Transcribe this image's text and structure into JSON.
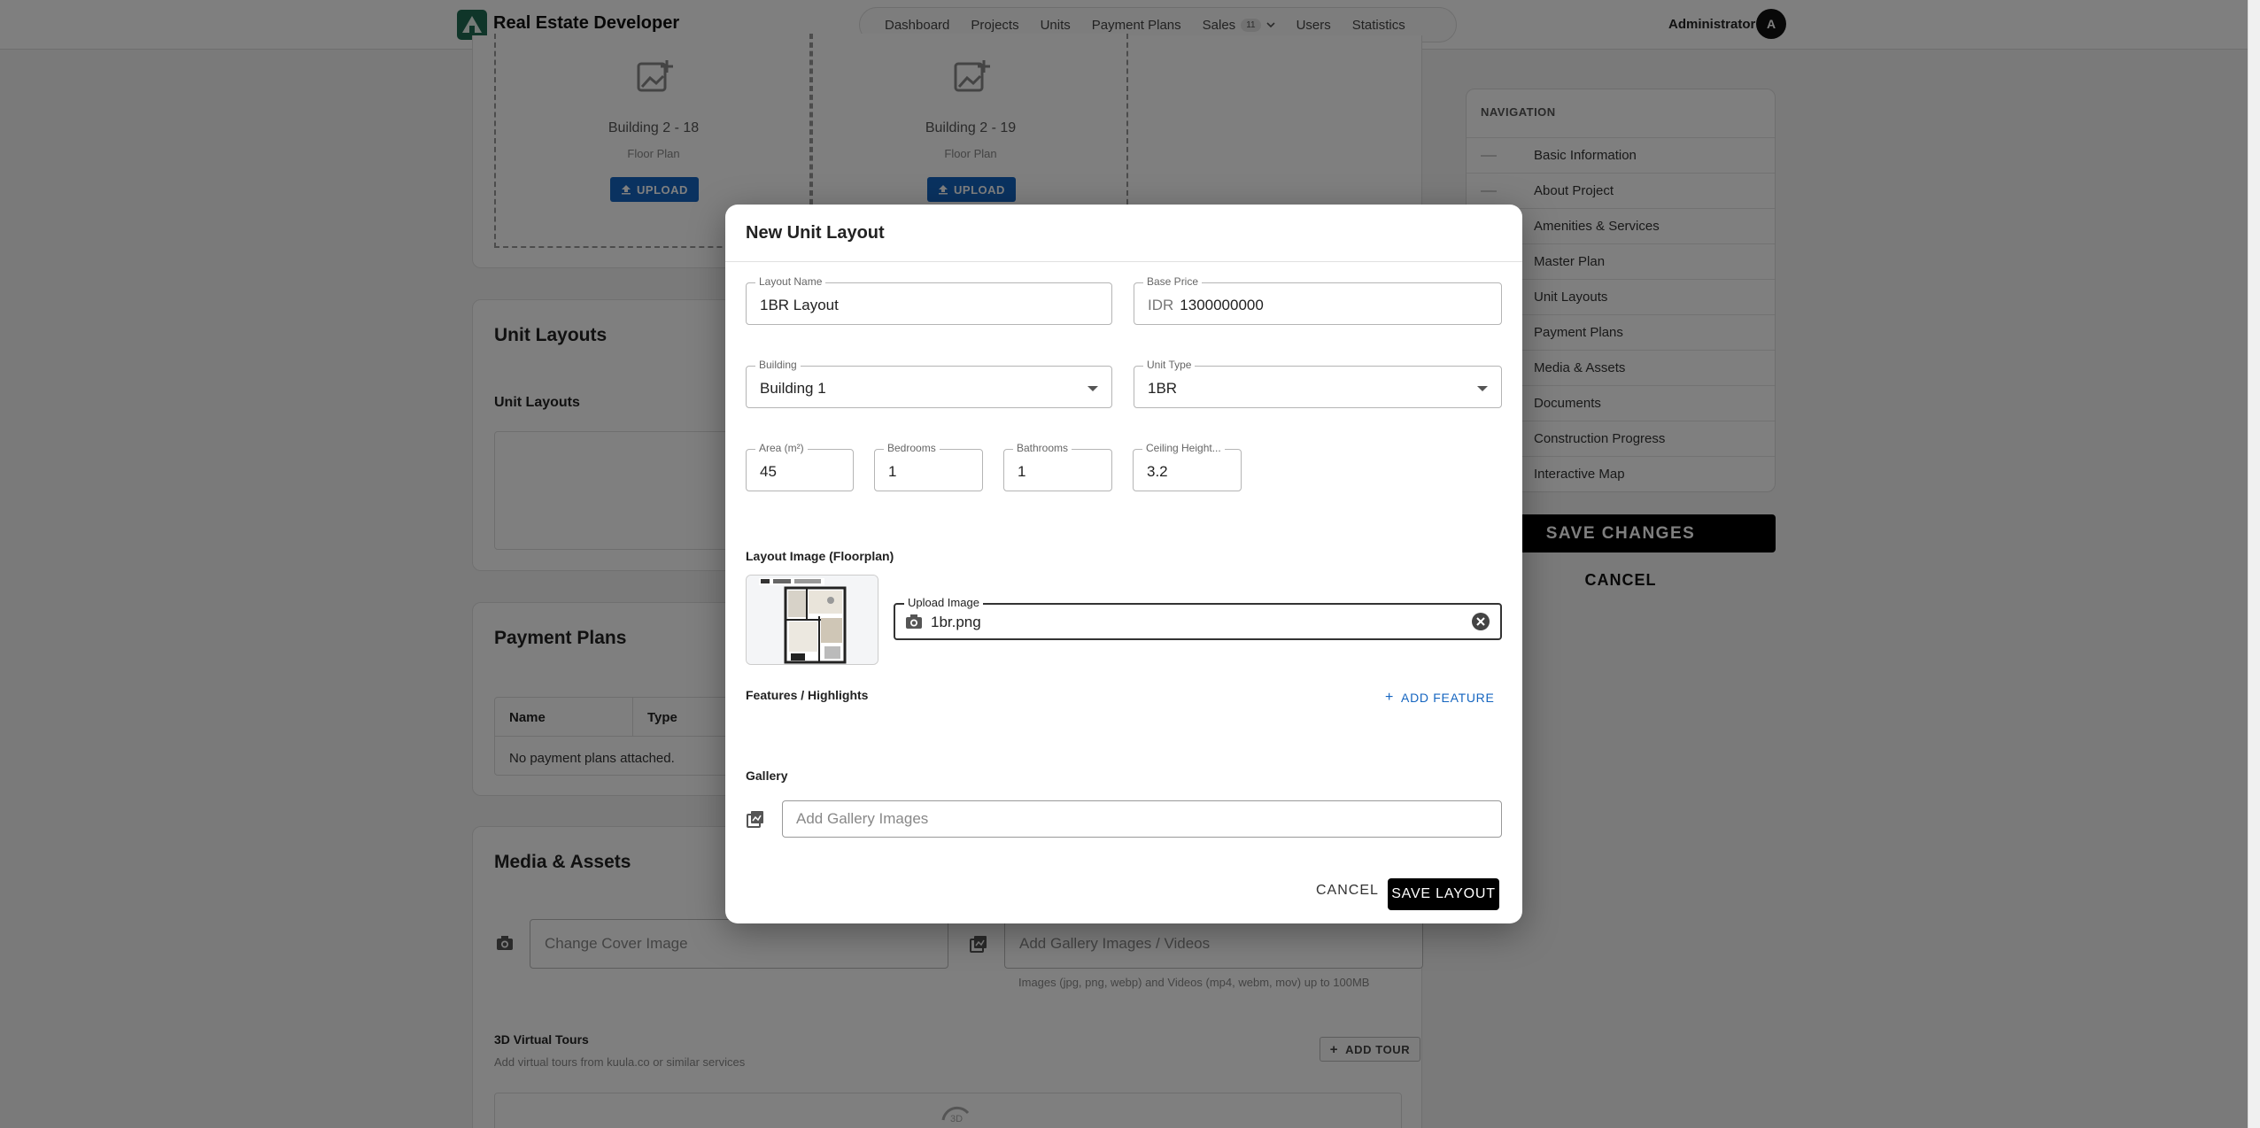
{
  "topbar": {
    "brand": "Real Estate Developer",
    "nav": [
      {
        "label": "Dashboard"
      },
      {
        "label": "Projects"
      },
      {
        "label": "Units"
      },
      {
        "label": "Payment Plans"
      },
      {
        "label": "Sales",
        "badge": "11"
      },
      {
        "label": "Users"
      },
      {
        "label": "Statistics"
      }
    ],
    "user_name": "Administrator",
    "avatar_initial": "A"
  },
  "floor_plans": [
    {
      "name": "Building 2 - 18",
      "type": "Floor Plan",
      "upload_label": "UPLOAD"
    },
    {
      "name": "Building 2 - 19",
      "type": "Floor Plan",
      "upload_label": "UPLOAD"
    }
  ],
  "sections": {
    "unit_layouts_title": "Unit Layouts",
    "unit_layouts_subtitle": "Unit Layouts",
    "payment_plans_title": "Payment Plans",
    "payment_plans_columns": [
      "Name",
      "Type"
    ],
    "payment_plans_empty": "No payment plans attached.",
    "media_title": "Media & Assets",
    "change_cover_placeholder": "Change Cover Image",
    "add_gallery_media_placeholder": "Add Gallery Images / Videos",
    "media_hint": "Images (jpg, png, webp) and Videos (mp4, webm, mov) up to 100MB",
    "tours_title": "3D Virtual Tours",
    "tours_hint": "Add virtual tours from kuula.co or similar services",
    "add_tour_label": "ADD TOUR"
  },
  "side_nav": {
    "title": "NAVIGATION",
    "items": [
      "Basic Information",
      "About Project",
      "Amenities & Services",
      "Master Plan",
      "Unit Layouts",
      "Payment Plans",
      "Media & Assets",
      "Documents",
      "Construction Progress",
      "Interactive Map"
    ],
    "save_label": "SAVE CHANGES",
    "cancel_label": "CANCEL"
  },
  "dialog": {
    "title": "New Unit Layout",
    "layout_name": {
      "label": "Layout Name",
      "value": "1BR Layout"
    },
    "base_price": {
      "label": "Base Price",
      "currency": "IDR",
      "value": "1300000000"
    },
    "building": {
      "label": "Building",
      "value": "Building 1"
    },
    "unit_type": {
      "label": "Unit Type",
      "value": "1BR"
    },
    "area": {
      "label": "Area (m²)",
      "value": "45"
    },
    "bedrooms": {
      "label": "Bedrooms",
      "value": "1"
    },
    "bathrooms": {
      "label": "Bathrooms",
      "value": "1"
    },
    "ceiling": {
      "label": "Ceiling Height...",
      "value": "3.2"
    },
    "layout_image_label": "Layout Image (Floorplan)",
    "upload": {
      "label": "Upload Image",
      "value": "1br.png"
    },
    "features_label": "Features / Highlights",
    "add_feature_label": "ADD FEATURE",
    "gallery_label": "Gallery",
    "gallery_placeholder": "Add Gallery Images",
    "cancel_label": "CANCEL",
    "save_label": "SAVE LAYOUT"
  },
  "colors": {
    "brand_green": "#1f6b52",
    "upload_blue": "#1565c0",
    "primary_black": "#000000",
    "overlay": "rgba(0,0,0,0.5)"
  }
}
